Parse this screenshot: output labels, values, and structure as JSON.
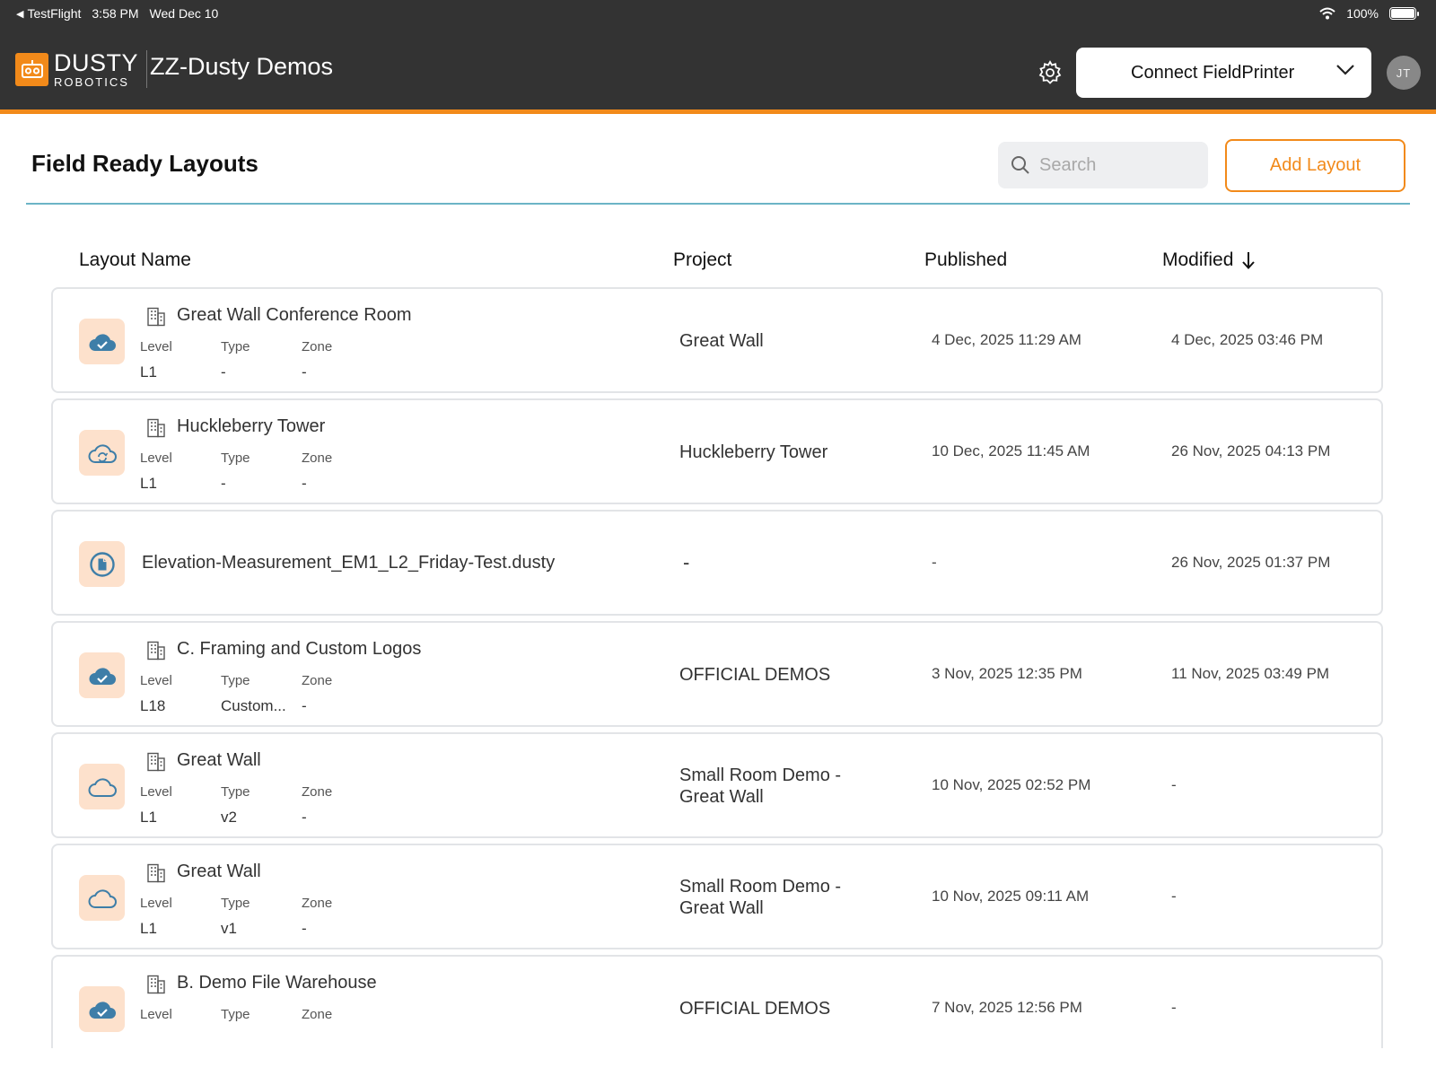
{
  "status_bar": {
    "back_app": "TestFlight",
    "time": "3:58 PM",
    "date": "Wed Dec 10",
    "battery": "100%",
    "battery_level": 1.0
  },
  "header": {
    "logo_line1": "DUSTY",
    "logo_line2": "ROBOTICS",
    "workspace": "ZZ-Dusty Demos",
    "connect_label": "Connect FieldPrinter",
    "avatar_initials": "JT",
    "icons": [
      "settings-gear-icon",
      "chevron-down-icon"
    ]
  },
  "page": {
    "title": "Field Ready Layouts",
    "search_placeholder": "Search",
    "add_button": "Add Layout"
  },
  "columns": {
    "layout_name": "Layout Name",
    "project": "Project",
    "published": "Published",
    "modified": "Modified"
  },
  "meta_labels": {
    "level": "Level",
    "type": "Type",
    "zone": "Zone"
  },
  "rows": [
    {
      "status_icon": "cloud-check-icon",
      "name": "Great Wall Conference Room",
      "level": "L1",
      "type": "-",
      "zone": "-",
      "project": "Great Wall",
      "published": "4 Dec, 2025 11:29 AM",
      "modified": "4 Dec, 2025 03:46 PM"
    },
    {
      "status_icon": "cloud-sync-icon",
      "name": "Huckleberry Tower",
      "level": "L1",
      "type": "-",
      "zone": "-",
      "project": "Huckleberry Tower",
      "published": "10 Dec, 2025 11:45 AM",
      "modified": "26 Nov, 2025 04:13 PM"
    },
    {
      "status_icon": "file-icon",
      "name": "Elevation-Measurement_EM1_L2_Friday-Test.dusty",
      "project": "-",
      "published": "-",
      "modified": "26 Nov, 2025 01:37 PM"
    },
    {
      "status_icon": "cloud-check-icon",
      "name": "C. Framing and Custom Logos",
      "level": "L18",
      "type": "Custom...",
      "zone": "-",
      "project": "OFFICIAL DEMOS",
      "published": "3 Nov, 2025 12:35 PM",
      "modified": "11 Nov, 2025 03:49 PM"
    },
    {
      "status_icon": "cloud-icon",
      "name": "Great Wall",
      "level": "L1",
      "type": "v2",
      "zone": "-",
      "project_line1": "Small Room Demo -",
      "project_line2": "Great Wall",
      "published": "10 Nov, 2025 02:52 PM",
      "modified": "-"
    },
    {
      "status_icon": "cloud-icon",
      "name": "Great Wall",
      "level": "L1",
      "type": "v1",
      "zone": "-",
      "project_line1": "Small Room Demo -",
      "project_line2": "Great Wall",
      "published": "10 Nov, 2025 09:11 AM",
      "modified": "-"
    },
    {
      "status_icon": "cloud-check-icon",
      "name": "B. Demo File Warehouse",
      "project": "OFFICIAL DEMOS",
      "published": "7 Nov, 2025 12:56 PM",
      "modified": "-"
    }
  ],
  "colors": {
    "brand_orange": "#f28a1a",
    "header_bg": "#333333",
    "icon_tile": "#fde1cc",
    "icon_blue": "#3e7ea8",
    "rule_teal": "#6cb4c6"
  }
}
